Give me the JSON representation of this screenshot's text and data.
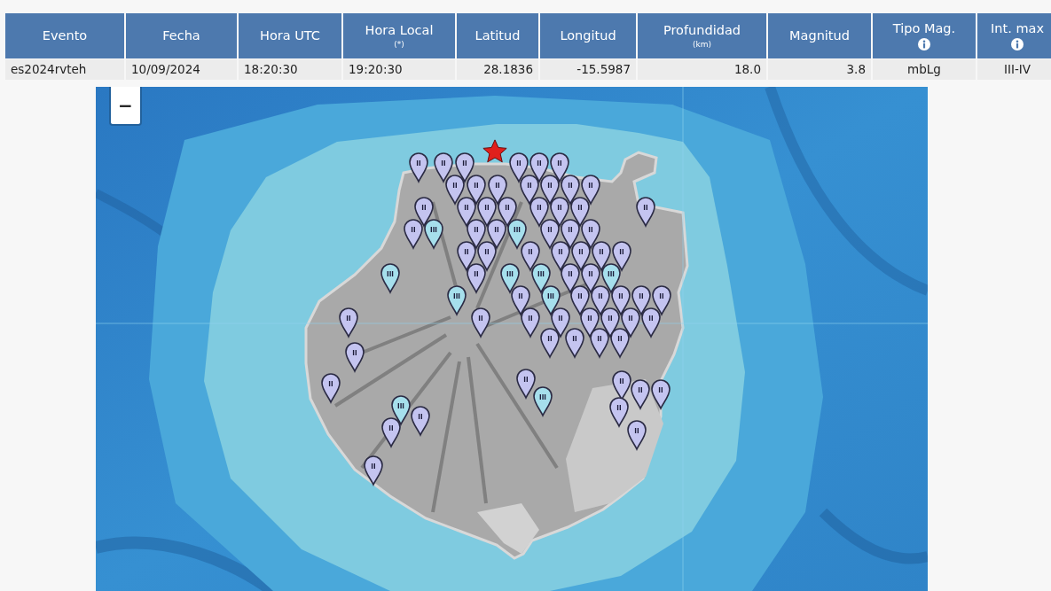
{
  "table": {
    "columns": [
      {
        "title": "Evento"
      },
      {
        "title": "Fecha"
      },
      {
        "title": "Hora UTC"
      },
      {
        "title": "Hora Local",
        "note": "(*)"
      },
      {
        "title": "Latitud"
      },
      {
        "title": "Longitud"
      },
      {
        "title": "Profundidad",
        "note": "(km)"
      },
      {
        "title": "Magnitud"
      },
      {
        "title": "Tipo Mag.",
        "info": true
      },
      {
        "title": "Int. max",
        "info": true
      }
    ],
    "rows": [
      [
        "es2024rvteh",
        "10/09/2024",
        "18:20:30",
        "19:20:30",
        "28.1836",
        "-15.5987",
        "18.0",
        "3.8",
        "mbLg",
        "III-IV"
      ]
    ]
  },
  "map": {
    "zoom_out": "−",
    "markers": [
      {
        "label": "II",
        "color": "#c4c4f0"
      },
      {
        "label": "II",
        "color": "#c4c4f0"
      },
      {
        "label": "II",
        "color": "#c4c4f0"
      },
      {
        "label": "II",
        "color": "#c4c4f0"
      },
      {
        "label": "II",
        "color": "#c4c4f0"
      },
      {
        "label": "II",
        "color": "#c4c4f0"
      },
      {
        "label": "II",
        "color": "#c4c4f0"
      },
      {
        "label": "II",
        "color": "#c4c4f0"
      },
      {
        "label": "II",
        "color": "#c4c4f0"
      },
      {
        "label": "II",
        "color": "#c4c4f0"
      },
      {
        "label": "II",
        "color": "#c4c4f0"
      },
      {
        "label": "II",
        "color": "#c4c4f0"
      },
      {
        "label": "II",
        "color": "#c4c4f0"
      },
      {
        "label": "II",
        "color": "#c4c4f0"
      },
      {
        "label": "II",
        "color": "#c4c4f0"
      },
      {
        "label": "II",
        "color": "#c4c4f0"
      },
      {
        "label": "II",
        "color": "#c4c4f0"
      },
      {
        "label": "II",
        "color": "#c4c4f0"
      },
      {
        "label": "II",
        "color": "#c4c4f0"
      },
      {
        "label": "II",
        "color": "#c4c4f0"
      },
      {
        "label": "II",
        "color": "#c4c4f0"
      },
      {
        "label": "II",
        "color": "#c4c4f0"
      },
      {
        "label": "III",
        "color": "#a6dfec"
      },
      {
        "label": "II",
        "color": "#c4c4f0"
      },
      {
        "label": "II",
        "color": "#c4c4f0"
      },
      {
        "label": "III",
        "color": "#a6dfec"
      },
      {
        "label": "II",
        "color": "#c4c4f0"
      },
      {
        "label": "II",
        "color": "#c4c4f0"
      },
      {
        "label": "II",
        "color": "#c4c4f0"
      },
      {
        "label": "II",
        "color": "#c4c4f0"
      },
      {
        "label": "II",
        "color": "#c4c4f0"
      },
      {
        "label": "II",
        "color": "#c4c4f0"
      },
      {
        "label": "II",
        "color": "#c4c4f0"
      },
      {
        "label": "II",
        "color": "#c4c4f0"
      },
      {
        "label": "II",
        "color": "#c4c4f0"
      },
      {
        "label": "II",
        "color": "#c4c4f0"
      },
      {
        "label": "III",
        "color": "#a6dfec"
      },
      {
        "label": "II",
        "color": "#c4c4f0"
      },
      {
        "label": "III",
        "color": "#a6dfec"
      },
      {
        "label": "III",
        "color": "#a6dfec"
      },
      {
        "label": "II",
        "color": "#c4c4f0"
      },
      {
        "label": "II",
        "color": "#c4c4f0"
      },
      {
        "label": "III",
        "color": "#a6dfec"
      },
      {
        "label": "III",
        "color": "#a6dfec"
      },
      {
        "label": "II",
        "color": "#c4c4f0"
      },
      {
        "label": "III",
        "color": "#a6dfec"
      },
      {
        "label": "II",
        "color": "#c4c4f0"
      },
      {
        "label": "II",
        "color": "#c4c4f0"
      },
      {
        "label": "II",
        "color": "#c4c4f0"
      },
      {
        "label": "II",
        "color": "#c4c4f0"
      },
      {
        "label": "II",
        "color": "#c4c4f0"
      },
      {
        "label": "II",
        "color": "#c4c4f0"
      },
      {
        "label": "II",
        "color": "#c4c4f0"
      },
      {
        "label": "II",
        "color": "#c4c4f0"
      },
      {
        "label": "II",
        "color": "#c4c4f0"
      },
      {
        "label": "II",
        "color": "#c4c4f0"
      },
      {
        "label": "II",
        "color": "#c4c4f0"
      },
      {
        "label": "II",
        "color": "#c4c4f0"
      },
      {
        "label": "II",
        "color": "#c4c4f0"
      },
      {
        "label": "II",
        "color": "#c4c4f0"
      },
      {
        "label": "II",
        "color": "#c4c4f0"
      },
      {
        "label": "II",
        "color": "#c4c4f0"
      },
      {
        "label": "II",
        "color": "#c4c4f0"
      },
      {
        "label": "II",
        "color": "#c4c4f0"
      },
      {
        "label": "II",
        "color": "#c4c4f0"
      },
      {
        "label": "II",
        "color": "#c4c4f0"
      },
      {
        "label": "II",
        "color": "#c4c4f0"
      },
      {
        "label": "III",
        "color": "#a6dfec"
      },
      {
        "label": "II",
        "color": "#c4c4f0"
      },
      {
        "label": "II",
        "color": "#c4c4f0"
      },
      {
        "label": "III",
        "color": "#a6dfec"
      },
      {
        "label": "II",
        "color": "#c4c4f0"
      },
      {
        "label": "II",
        "color": "#c4c4f0"
      },
      {
        "label": "II",
        "color": "#c4c4f0"
      },
      {
        "label": "II",
        "color": "#c4c4f0"
      },
      {
        "label": "II",
        "color": "#c4c4f0"
      }
    ]
  }
}
